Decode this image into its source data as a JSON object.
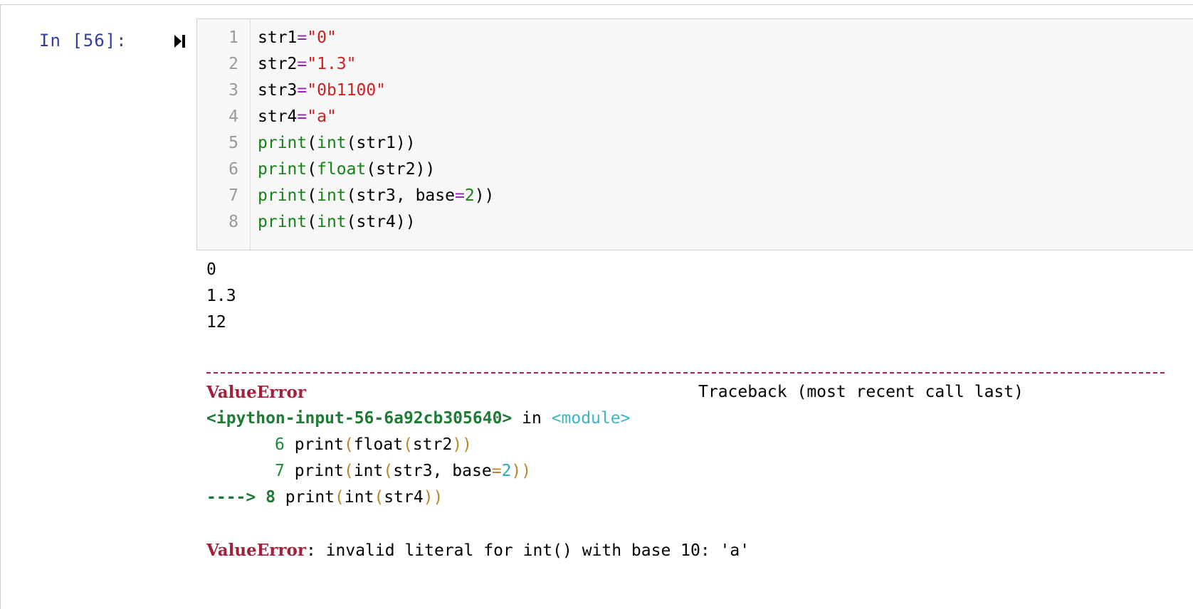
{
  "prompt": "In [56]:",
  "code": {
    "line_numbers": [
      "1",
      "2",
      "3",
      "4",
      "5",
      "6",
      "7",
      "8"
    ],
    "l1": {
      "name": "str1",
      "eq": "=",
      "val": "\"0\""
    },
    "l2": {
      "name": "str2",
      "eq": "=",
      "val": "\"1.3\""
    },
    "l3": {
      "name": "str3",
      "eq": "=",
      "val": "\"0b1100\""
    },
    "l4": {
      "name": "str4",
      "eq": "=",
      "val": "\"a\""
    },
    "l5": {
      "fn1": "print",
      "p1": "(",
      "fn2": "int",
      "p2": "(str1))"
    },
    "l6": {
      "fn1": "print",
      "p1": "(",
      "fn2": "float",
      "p2": "(str2))"
    },
    "l7": {
      "fn1": "print",
      "p1": "(",
      "fn2": "int",
      "p2": "(str3, base",
      "eq": "=",
      "num": "2",
      "p3": "))"
    },
    "l8": {
      "fn1": "print",
      "p1": "(",
      "fn2": "int",
      "p2": "(str4))"
    }
  },
  "output": {
    "stdout": [
      "0",
      "1.3",
      "12"
    ],
    "error_name": "ValueError",
    "traceback_label": "Traceback (most recent call last)",
    "input_ref": "<ipython-input-56-6a92cb305640>",
    "in_word": " in ",
    "module": "<module>",
    "tb6": {
      "num": "6",
      "text1": " print",
      "p1": "(",
      "text2": "float",
      "p2": "(",
      "text3": "str2",
      "p3": "))"
    },
    "tb7": {
      "num": "7",
      "text1": " print",
      "p1": "(",
      "text2": "int",
      "p2": "(",
      "text3": "str3, base",
      "eq": "=",
      "n": "2",
      "p3": "))"
    },
    "tb8": {
      "arrow": "----> 8",
      "text1": " print",
      "p1": "(",
      "text2": "int",
      "p2": "(",
      "text3": "str4",
      "p3": "))"
    },
    "final_error_name": "ValueError",
    "final_error_msg": ": invalid literal for int() with base 10: 'a'"
  }
}
